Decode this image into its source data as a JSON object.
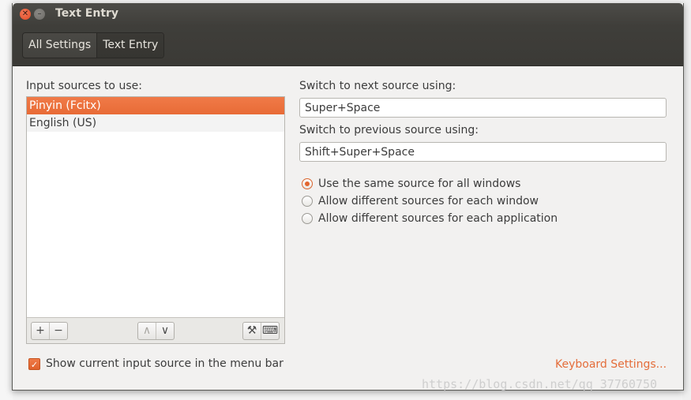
{
  "window": {
    "title": "Text Entry"
  },
  "breadcrumbs": [
    {
      "label": "All Settings"
    },
    {
      "label": "Text Entry"
    }
  ],
  "input_sources": {
    "heading": "Input sources to use:",
    "items": [
      {
        "label": "Pinyin (Fcitx)",
        "selected": true
      },
      {
        "label": "English (US)",
        "selected": false
      }
    ],
    "toolbar": {
      "add_label": "+",
      "remove_label": "−",
      "up_label": "∧",
      "down_label": "∨",
      "settings_label": "⚒",
      "keyboard_label": "⌨"
    }
  },
  "shortcuts": {
    "next_label": "Switch to next source using:",
    "next_value": "Super+Space",
    "prev_label": "Switch to previous source using:",
    "prev_value": "Shift+Super+Space"
  },
  "scope_options": {
    "selected_index": 0,
    "items": [
      {
        "label": "Use the same source for all windows"
      },
      {
        "label": "Allow different sources for each window"
      },
      {
        "label": "Allow different sources for each application"
      }
    ]
  },
  "show_in_menu_bar": {
    "label": "Show current input source in the menu bar",
    "checked": true
  },
  "keyboard_settings_link": "Keyboard Settings...",
  "watermark": "https://blog.csdn.net/qq_37760750",
  "colors": {
    "accent": "#e86b36",
    "titlebar": "#3f3e3a"
  }
}
